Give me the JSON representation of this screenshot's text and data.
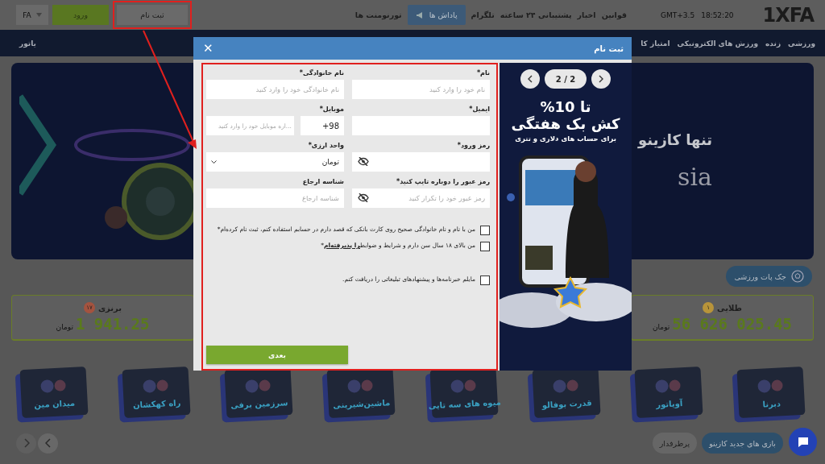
{
  "header": {
    "logo": "1XFA",
    "time": "18:52:20",
    "timezone": "GMT+3.5",
    "links": [
      {
        "label": "قوانین",
        "kind": "link"
      },
      {
        "label": "اخبار",
        "kind": "link"
      },
      {
        "label": "پشتیبانی ۲۴ ساعته",
        "kind": "link"
      },
      {
        "label": "تلگرام",
        "kind": "link"
      },
      {
        "label": "پاداش ها",
        "kind": "button"
      },
      {
        "label": "تورنومنت ها",
        "kind": "link"
      }
    ],
    "register": "ثبت نام",
    "login": "ورود",
    "language": "FA"
  },
  "nav": {
    "items": [
      "ورزشی",
      "زنده",
      "ورزش های الکترونیکی",
      "امتیاز کا"
    ],
    "far_item": "یاتور"
  },
  "banner": {
    "title": "تنها کازینو",
    "subtitle": "sia"
  },
  "jackpot": {
    "button": "جک پات ورزشی",
    "cards": [
      {
        "tier": "طلایی",
        "badge": "۱",
        "amount": "56 626 025.45",
        "currency": "تومان",
        "color": "#b8943a"
      },
      {
        "tier": "برنزی",
        "badge": "۱۷",
        "amount": "1 941.25",
        "currency": "تومان",
        "color": "#a4533f"
      }
    ]
  },
  "games": [
    "دبرنا",
    "آویاتور",
    "قدرت بوفالو",
    "میوه های سه تایی",
    "ماشین‌شیرینی",
    "سرزمین برفی",
    "راه کهکشان",
    "میدان مین"
  ],
  "categories": [
    {
      "label": "بازی های جدید کازینو",
      "selected": true
    },
    {
      "label": "پرطرفدار",
      "selected": false
    }
  ],
  "modal": {
    "title": "ثبت نام",
    "close": "✕",
    "fields": [
      {
        "kind": "text",
        "label": "نام*",
        "placeholder": "نام خود را وارد کنید"
      },
      {
        "kind": "text",
        "label": "نام خانوادگی*",
        "placeholder": "نام خانوادگی خود را وارد کنید"
      },
      {
        "kind": "text",
        "label": "ایمیل*"
      },
      {
        "kind": "phone",
        "label": "موبایل*",
        "prefix": "+98",
        "placeholder": "...اره موبایل خود را وارد کنید"
      },
      {
        "kind": "password",
        "label": "رمز ورود*"
      },
      {
        "kind": "select",
        "label": "واحد ارزی*",
        "value": "تومان"
      },
      {
        "kind": "password",
        "label": "رمز عبور را دوباره تایپ کنید*",
        "placeholder": "رمز عبور خود را تکرار کنید"
      },
      {
        "kind": "text",
        "label": "شناسه ارجاع",
        "placeholder": "شناسه ارجاع"
      }
    ],
    "consents": [
      {
        "text": "من با نام و نام خانوادگی صحیح روی کارت بانکی که قصد دارم در حسابم استفاده کنم، ثبت نام کرده‌ام",
        "suffix": "*",
        "checked": false
      },
      {
        "text": "من بالای ۱۸ سال سن دارم و شرایط و ضوابط",
        "link": "را پذیرفته‌ام",
        "suffix": "*",
        "checked": false
      },
      {
        "text": "مایلم خبرنامه‌ها و پیشنهادهای تبلیغاتی را دریافت کنم.",
        "checked": false
      }
    ],
    "next": "بعدی",
    "promo": {
      "page": "2 / 2",
      "headline": "تا 10%",
      "title": "کش بک هفتگی",
      "subtitle": "برای حساب های دلاری و تتری"
    }
  }
}
